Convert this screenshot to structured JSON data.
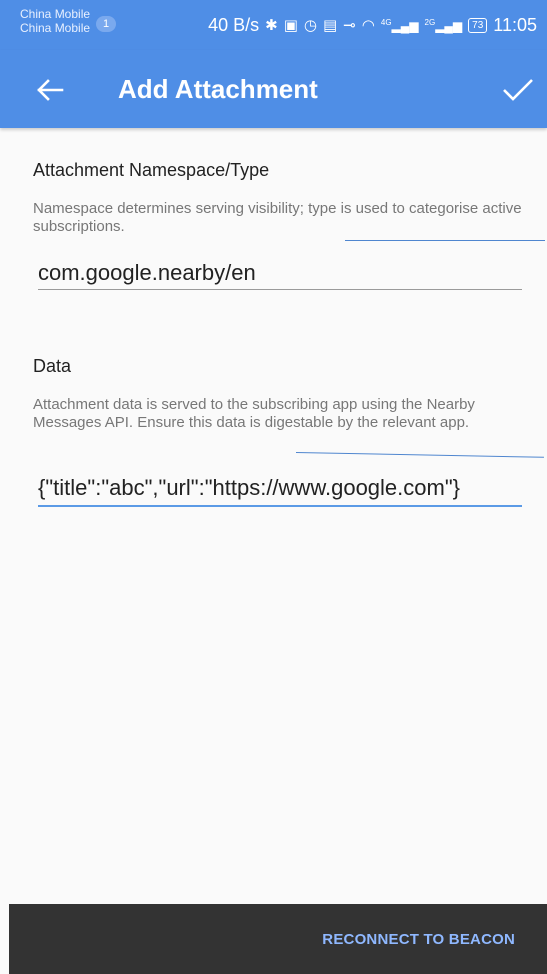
{
  "status_bar": {
    "carrier_1": "China Mobile",
    "carrier_2": "China Mobile",
    "notification_count": "1",
    "network_speed": "40 B/s",
    "signal_1_label": "4G",
    "signal_2_label": "2G",
    "battery": "73",
    "time": "11:05"
  },
  "app_bar": {
    "title": "Add Attachment",
    "back_icon": "arrow-back-icon",
    "confirm_icon": "check-icon"
  },
  "namespace_section": {
    "title": "Attachment Namespace/Type",
    "helper": "Namespace determines serving visibility; type is used to categorise active subscriptions.",
    "value": "com.google.nearby/en"
  },
  "data_section": {
    "title": "Data",
    "helper": "Attachment data is served to the subscribing app using the Nearby Messages API. Ensure this data is digestable by the relevant app.",
    "value": "{\"title\":\"abc\",\"url\":\"https://www.google.com\"}"
  },
  "bottom_bar": {
    "reconnect_label": "RECONNECT TO BEACON"
  },
  "colors": {
    "primary": "#4f8ee6",
    "accent_text": "#8fb8ff",
    "bottom_bar": "#333333"
  }
}
